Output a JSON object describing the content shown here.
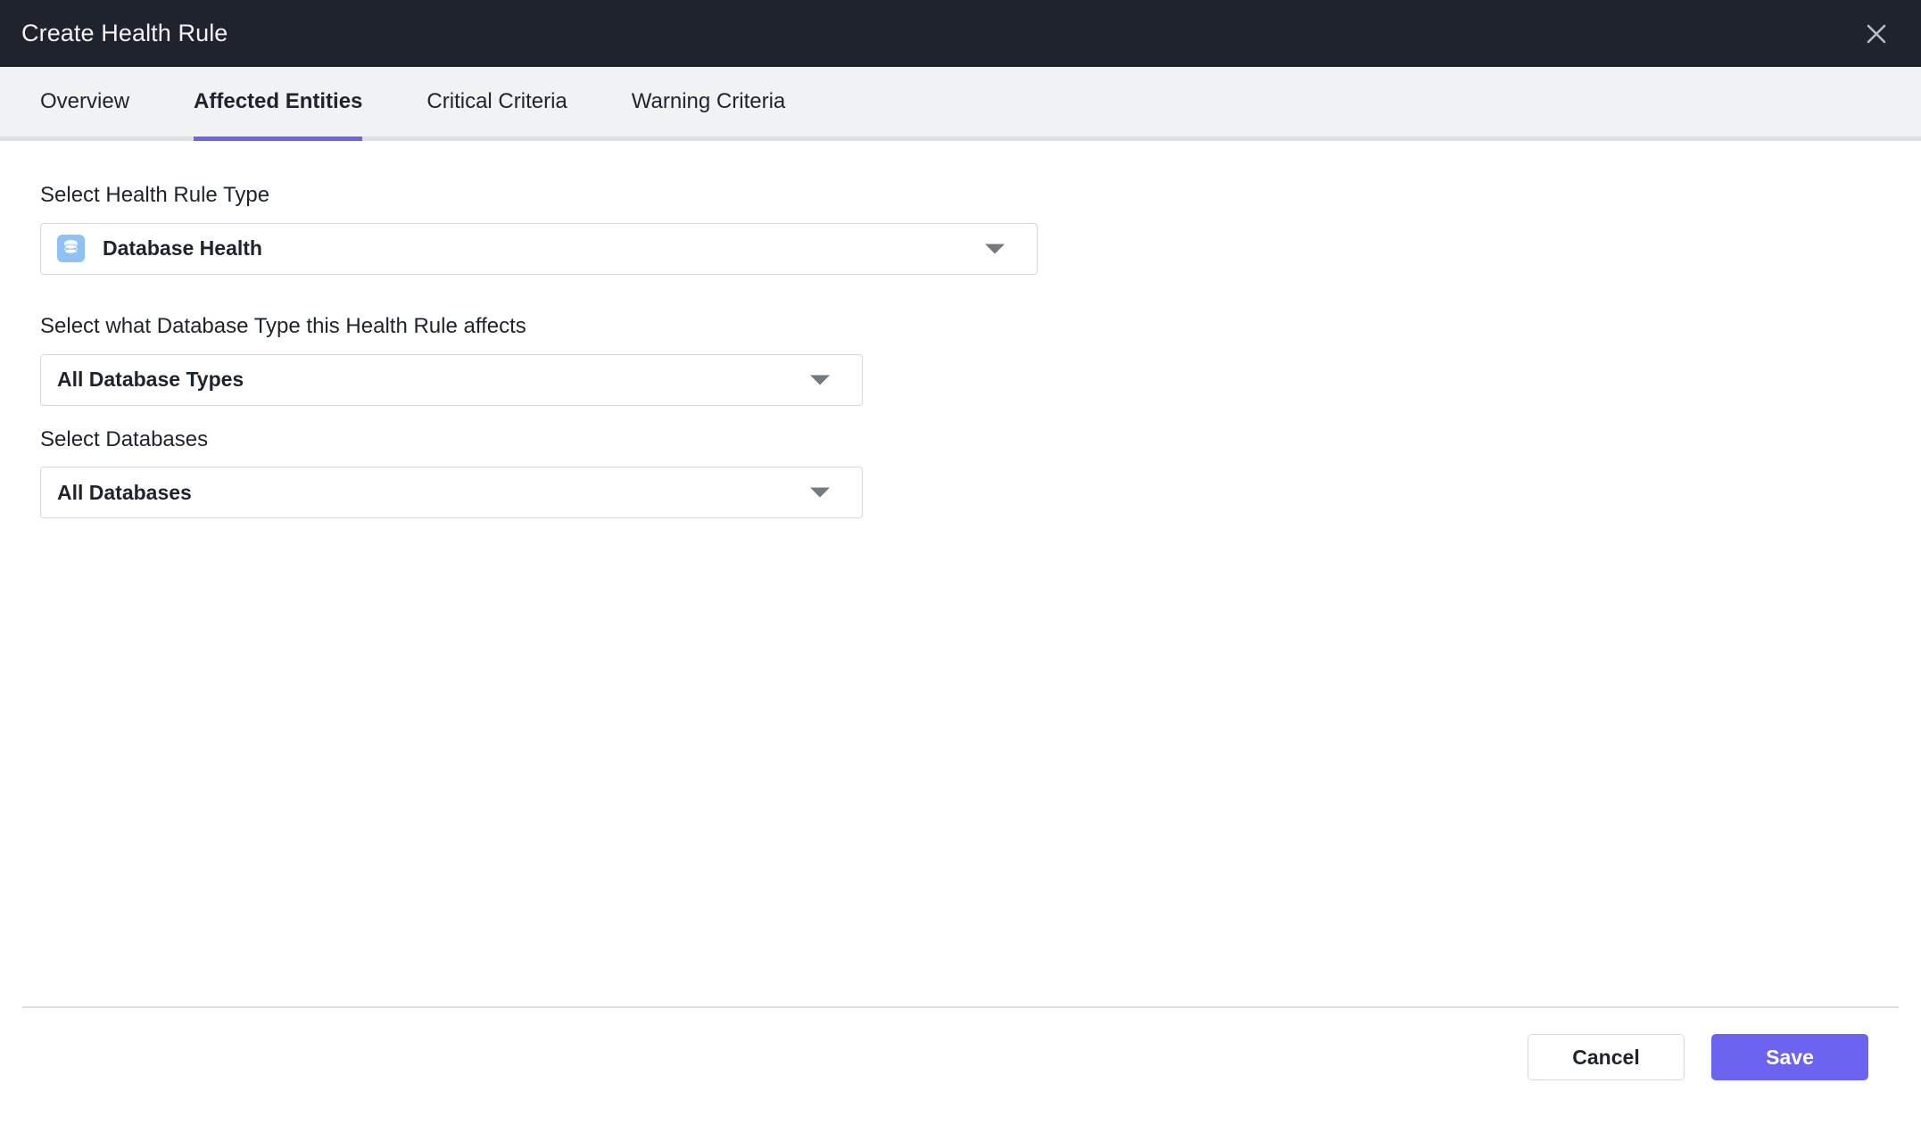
{
  "header": {
    "title": "Create Health Rule",
    "close_icon": "close-icon"
  },
  "tabs": [
    {
      "label": "Overview",
      "active": false
    },
    {
      "label": "Affected Entities",
      "active": true
    },
    {
      "label": "Critical Criteria",
      "active": false
    },
    {
      "label": "Warning Criteria",
      "active": false
    }
  ],
  "form": {
    "rule_type": {
      "label": "Select Health Rule Type",
      "value": "Database Health",
      "icon": "database-icon"
    },
    "database_type": {
      "label": "Select what Database Type this Health Rule affects",
      "value": "All Database Types"
    },
    "databases": {
      "label": "Select Databases",
      "value": "All Databases"
    }
  },
  "footer": {
    "cancel_label": "Cancel",
    "save_label": "Save"
  },
  "colors": {
    "header_bg": "#1e232e",
    "tabbar_bg": "#f1f2f4",
    "accent": "#6c63f0",
    "icon_chip": "#8dc2f2",
    "border": "#d5d9de",
    "text": "#1e232e"
  }
}
